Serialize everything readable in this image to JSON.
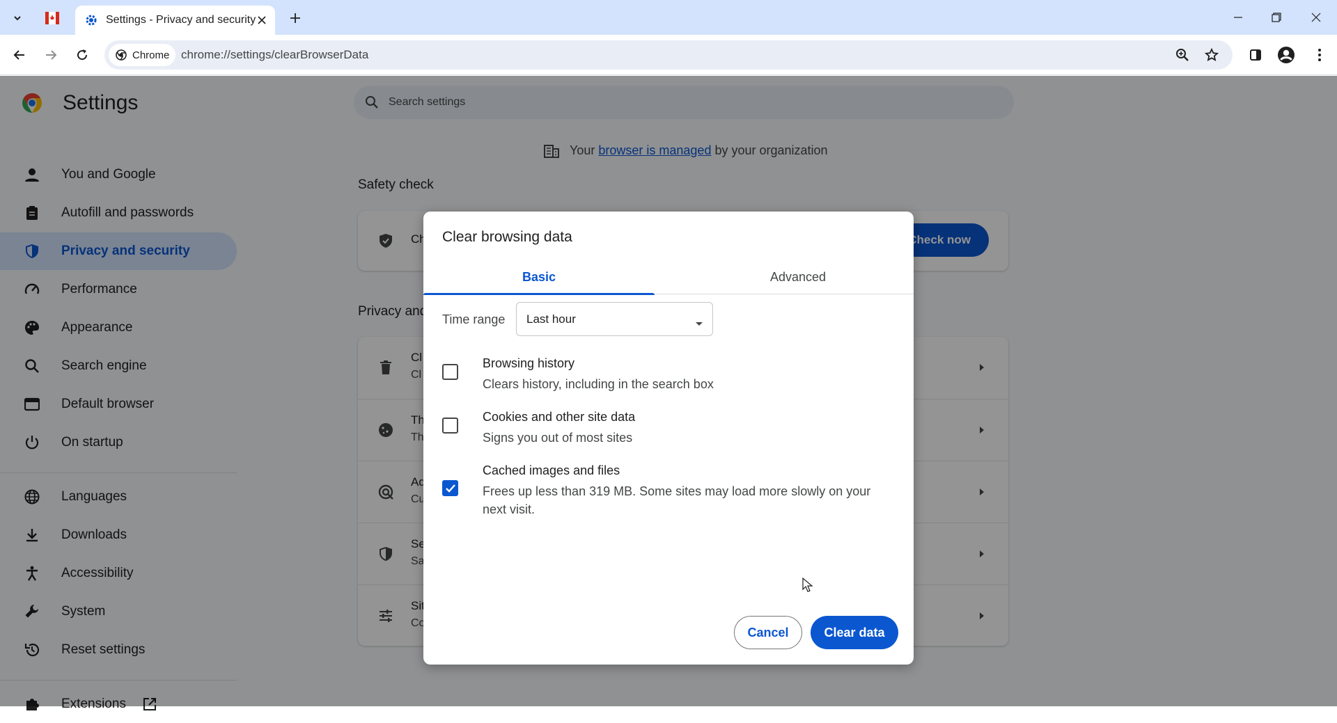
{
  "browser": {
    "tab_title": "Settings - Privacy and security",
    "site_chip_label": "Chrome",
    "url": "chrome://settings/clearBrowserData"
  },
  "settings": {
    "title": "Settings",
    "search_placeholder": "Search settings",
    "nav": [
      {
        "label": "You and Google",
        "icon": "person-icon"
      },
      {
        "label": "Autofill and passwords",
        "icon": "clipboard-icon"
      },
      {
        "label": "Privacy and security",
        "icon": "shield-icon",
        "active": true
      },
      {
        "label": "Performance",
        "icon": "speedometer-icon"
      },
      {
        "label": "Appearance",
        "icon": "palette-icon"
      },
      {
        "label": "Search engine",
        "icon": "search-icon"
      },
      {
        "label": "Default browser",
        "icon": "browser-window-icon"
      },
      {
        "label": "On startup",
        "icon": "power-icon"
      },
      {
        "label": "Languages",
        "icon": "globe-icon"
      },
      {
        "label": "Downloads",
        "icon": "download-icon"
      },
      {
        "label": "Accessibility",
        "icon": "accessibility-icon"
      },
      {
        "label": "System",
        "icon": "wrench-icon"
      },
      {
        "label": "Reset settings",
        "icon": "reset-icon"
      },
      {
        "label": "Extensions",
        "icon": "puzzle-icon"
      }
    ],
    "managed_notice": {
      "prefix": "Your",
      "link": "browser is managed",
      "suffix": "by your organization"
    },
    "safety_check": {
      "title": "Safety check",
      "row_text": "Ch",
      "button": "Check now"
    },
    "privacy_section": {
      "title": "Privacy and",
      "rows": [
        {
          "t1": "Cl",
          "t2": "Cl"
        },
        {
          "t1": "Th",
          "t2": "Th"
        },
        {
          "t1": "Ad",
          "t2": "Cu"
        },
        {
          "t1": "Se",
          "t2": "Sa"
        },
        {
          "t1": "Sit",
          "t2": "Co"
        }
      ]
    }
  },
  "dialog": {
    "title": "Clear browsing data",
    "tabs": [
      "Basic",
      "Advanced"
    ],
    "selected_tab": "Basic",
    "time_range_label": "Time range",
    "time_range_value": "Last hour",
    "options": [
      {
        "title": "Browsing history",
        "description": "Clears history, including in the search box",
        "checked": false
      },
      {
        "title": "Cookies and other site data",
        "description": "Signs you out of most sites",
        "checked": false
      },
      {
        "title": "Cached images and files",
        "description": "Frees up less than 319 MB. Some sites may load more slowly on your next visit.",
        "checked": true
      }
    ],
    "cancel_label": "Cancel",
    "clear_label": "Clear data"
  },
  "colors": {
    "accent": "#0b57d0",
    "tabstrip": "#d3e3fd",
    "page_bg": "#f8fafd"
  }
}
